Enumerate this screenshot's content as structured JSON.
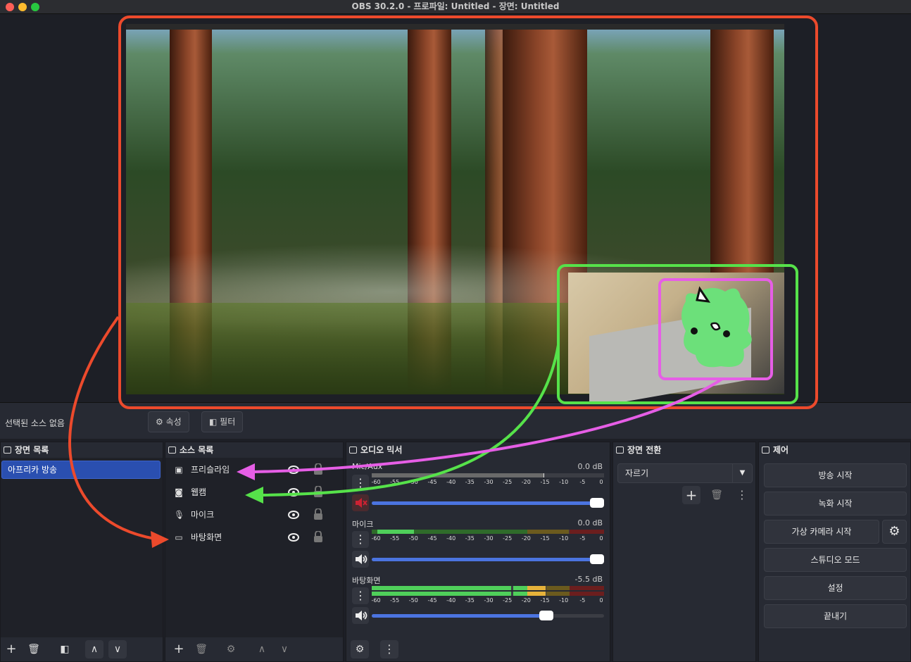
{
  "window": {
    "title": "OBS 30.2.0 - 프로파일: Untitled - 장면: Untitled"
  },
  "colors": {
    "close": "#fe5f57",
    "minimize": "#febc2e",
    "zoom": "#28c840",
    "annotation_red": "#ec4a2c",
    "annotation_green": "#56e24a",
    "annotation_pink": "#e65ee6",
    "selection": "#2a4fb0"
  },
  "context_bar": {
    "no_source": "선택된 소스 없음",
    "properties": "속성",
    "filters": "필터"
  },
  "scenes": {
    "title": "장면 목록",
    "items": [
      "아프리카 방송"
    ]
  },
  "sources": {
    "title": "소스 목록",
    "items": [
      {
        "name": "프리슬라임",
        "icon": "image-icon"
      },
      {
        "name": "웹캠",
        "icon": "camera-icon"
      },
      {
        "name": "마이크",
        "icon": "mic-icon"
      },
      {
        "name": "바탕화면",
        "icon": "monitor-icon"
      }
    ]
  },
  "mixer": {
    "title": "오디오 믹서",
    "channels": [
      {
        "name": "Mic/Aux",
        "db": "0.0 dB",
        "muted": true,
        "volume": 1.0
      },
      {
        "name": "마이크",
        "db": "0.0 dB",
        "muted": false,
        "volume": 1.0
      },
      {
        "name": "바탕화면",
        "db": "-5.5 dB",
        "muted": false,
        "volume": 0.75
      }
    ],
    "scale": [
      "-60",
      "-55",
      "-50",
      "-45",
      "-40",
      "-35",
      "-30",
      "-25",
      "-20",
      "-15",
      "-10",
      "-5",
      "0"
    ]
  },
  "transitions": {
    "title": "장면 전환",
    "selected": "자르기"
  },
  "controls": {
    "title": "제어",
    "start_stream": "방송 시작",
    "start_record": "녹화 시작",
    "virtual_cam": "가상 카메라 시작",
    "studio_mode": "스튜디오 모드",
    "settings": "설정",
    "exit": "끝내기"
  }
}
